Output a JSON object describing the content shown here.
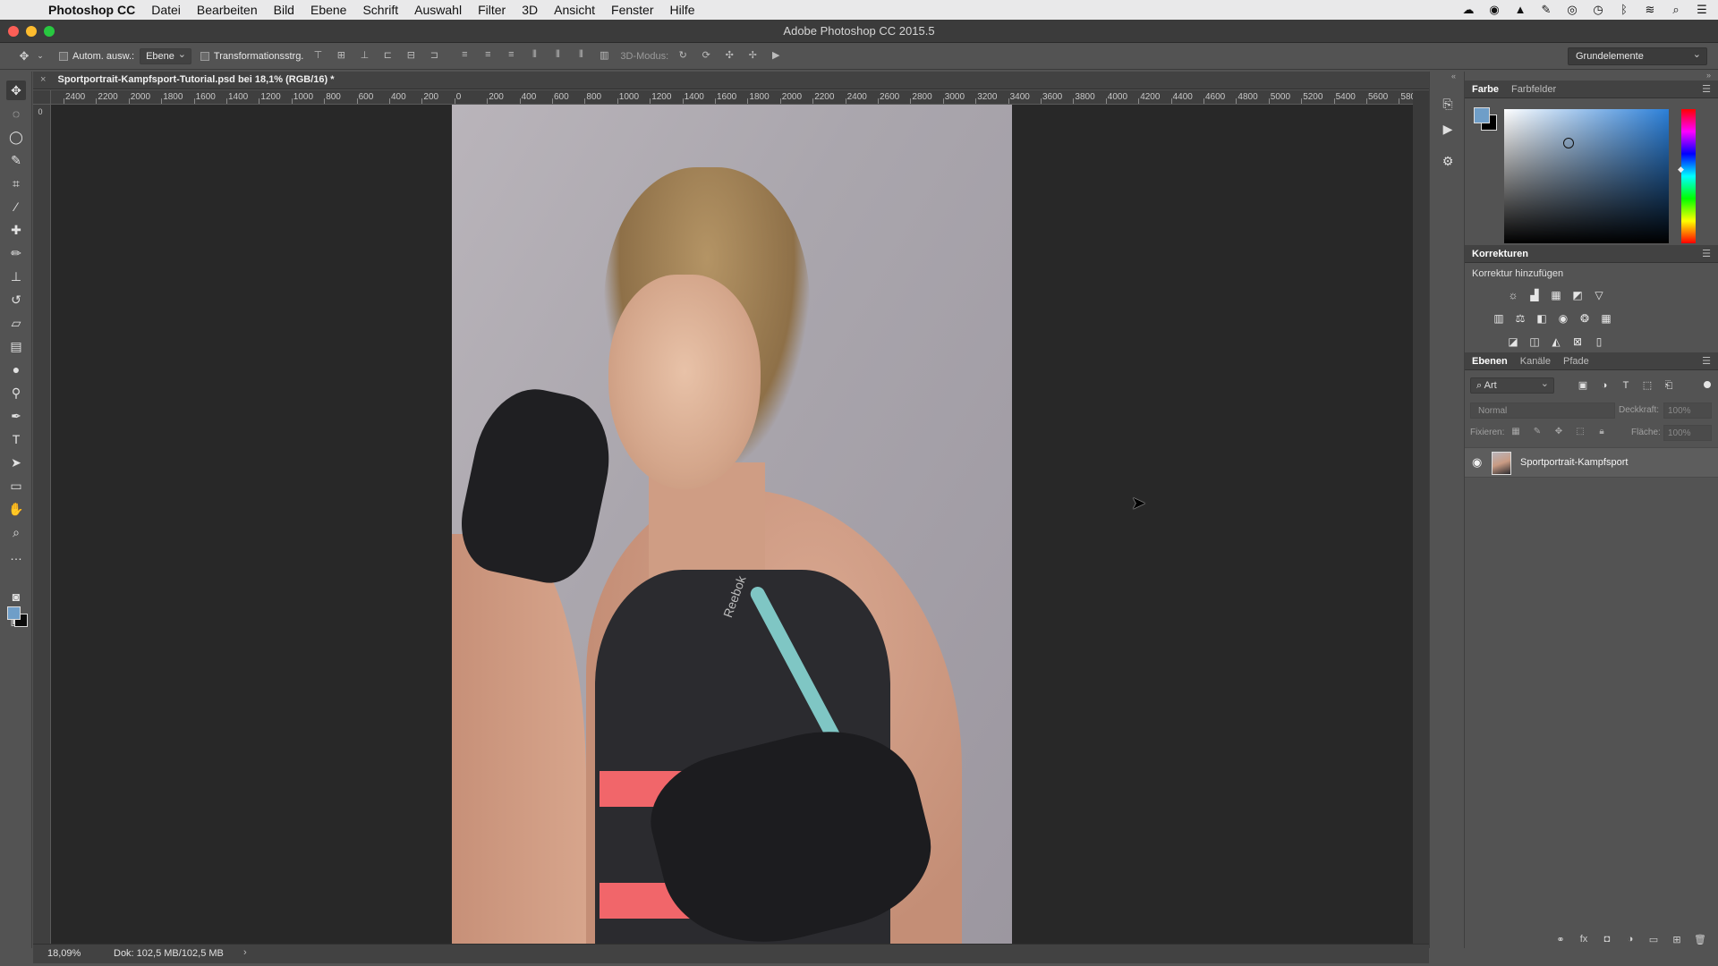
{
  "menubar": {
    "app_name": "Photoshop CC",
    "items": [
      "Datei",
      "Bearbeiten",
      "Bild",
      "Ebene",
      "Schrift",
      "Auswahl",
      "Filter",
      "3D",
      "Ansicht",
      "Fenster",
      "Hilfe"
    ],
    "status_icons": [
      "creative-cloud-icon",
      "cc-sync-icon",
      "drive-icon",
      "acrobat-icon",
      "record-icon",
      "time-machine-icon",
      "bluetooth-icon",
      "wifi-icon",
      "spotlight-icon",
      "notification-center-icon"
    ]
  },
  "window": {
    "title": "Adobe Photoshop CC 2015.5"
  },
  "options_bar": {
    "auto_select_label": "Autom. ausw.:",
    "auto_select_target": "Ebene",
    "transform_controls_label": "Transformationsstrg.",
    "mode_3d_label": "3D-Modus:",
    "workspace": "Grundelemente"
  },
  "document": {
    "tab_title": "Sportportrait-Kampfsport-Tutorial.psd bei 18,1% (RGB/16) *",
    "zoom": "18,09%",
    "doc_info": "Dok: 102,5 MB/102,5 MB"
  },
  "ruler": {
    "top_labels": [
      "2400",
      "2200",
      "2000",
      "1800",
      "1600",
      "1400",
      "1200",
      "1000",
      "800",
      "600",
      "400",
      "200",
      "0",
      "200",
      "400",
      "600",
      "800",
      "1000",
      "1200",
      "1400",
      "1600",
      "1800",
      "2000",
      "2200",
      "2400",
      "2600",
      "2800",
      "3000",
      "3200",
      "3400",
      "3600",
      "3800",
      "4000",
      "4200",
      "4400",
      "4600",
      "4800",
      "5000",
      "5200",
      "5400",
      "5600",
      "580"
    ]
  },
  "photo": {
    "shirt_brand": "Reebok"
  },
  "panels": {
    "color": {
      "tabs": [
        "Farbe",
        "Farbfelder"
      ],
      "fg_color": "#6f9ec8",
      "bg_color": "#000000"
    },
    "adjustments": {
      "title": "Korrekturen",
      "subtitle": "Korrektur hinzufügen",
      "row1": [
        "brightness-icon",
        "levels-icon",
        "curves-icon",
        "exposure-icon",
        "vibrance-icon"
      ],
      "row2": [
        "hue-saturation-icon",
        "color-balance-icon",
        "black-white-icon",
        "photo-filter-icon",
        "channel-mixer-icon",
        "color-lookup-icon"
      ],
      "row3": [
        "invert-icon",
        "posterize-icon",
        "threshold-icon",
        "selective-color-icon",
        "gradient-map-icon"
      ]
    },
    "layers": {
      "tabs": [
        "Ebenen",
        "Kanäle",
        "Pfade"
      ],
      "filter_kind": "Art",
      "blend_mode": "Normal",
      "opacity_label": "Deckkraft:",
      "opacity_value": "100%",
      "lock_label": "Fixieren:",
      "fill_label": "Fläche:",
      "fill_value": "100%",
      "items": [
        {
          "name": "Sportportrait-Kampfsport",
          "visible": true
        }
      ]
    }
  }
}
